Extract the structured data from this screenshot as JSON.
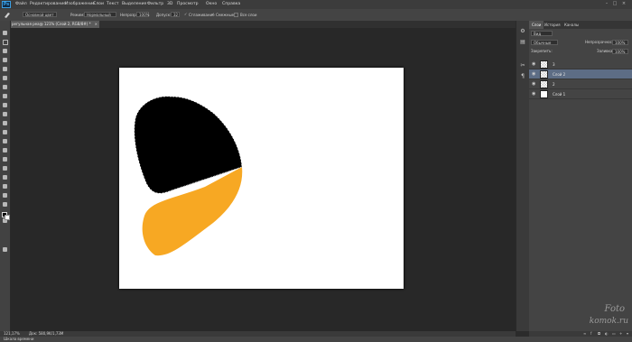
{
  "app": {
    "logo": "Ps",
    "menu": [
      "Файл",
      "Редактирование",
      "Изображение",
      "Слои",
      "Текст",
      "Выделение",
      "Фильтр",
      "3D",
      "Просмотр",
      "Окно",
      "Справка"
    ],
    "window_controls": [
      "–",
      "□",
      "×"
    ]
  },
  "options_bar": {
    "tool_icon": "brush-tool-icon",
    "tool_preset": "Основной цвет",
    "mode_label": "Режим:",
    "mode_value": "Нормальный",
    "opacity_label": "Непрозр.:",
    "opacity_value": "100%",
    "tolerance_label": "Допуск:",
    "tolerance_value": "32",
    "antialias_label": "Сглаживание",
    "contiguous_label": "Смежные",
    "all_layers_label": "Все слои"
  },
  "document": {
    "tab_title": "регульная реа@ 121% (Слой 2, RGB/8#) *",
    "background_color": "#ffffff",
    "shapes": [
      {
        "name": "black-wing-shape",
        "fill": "#000000"
      },
      {
        "name": "orange-wing-shape",
        "fill": "#f7a823"
      }
    ]
  },
  "status": {
    "zoom": "121,17%",
    "doc_size": "Док: 580,9K/1,73M",
    "timeline_label": "Шкала времени"
  },
  "panel": {
    "tabs": [
      "Слои",
      "История",
      "Каналы"
    ],
    "kind_filter": "Вид",
    "blend_mode": "Обычные",
    "opacity_label": "Непрозрачность:",
    "opacity_value": "100%",
    "lock_label": "Закрепить:",
    "fill_label": "Заливка:",
    "fill_value": "100%",
    "layers": [
      {
        "name": "3",
        "thumb": "checker",
        "selected": false
      },
      {
        "name": "Слой 2",
        "thumb": "checker",
        "selected": true
      },
      {
        "name": "2",
        "thumb": "checker",
        "selected": false
      },
      {
        "name": "Слой 1",
        "thumb": "white",
        "selected": false
      }
    ]
  },
  "watermark": {
    "line1": "Foto",
    "line2": "komok.ru"
  },
  "colors": {
    "foreground": "#000000",
    "background": "#ffffff",
    "selection": "#5d6d85",
    "orange": "#f7a823"
  }
}
